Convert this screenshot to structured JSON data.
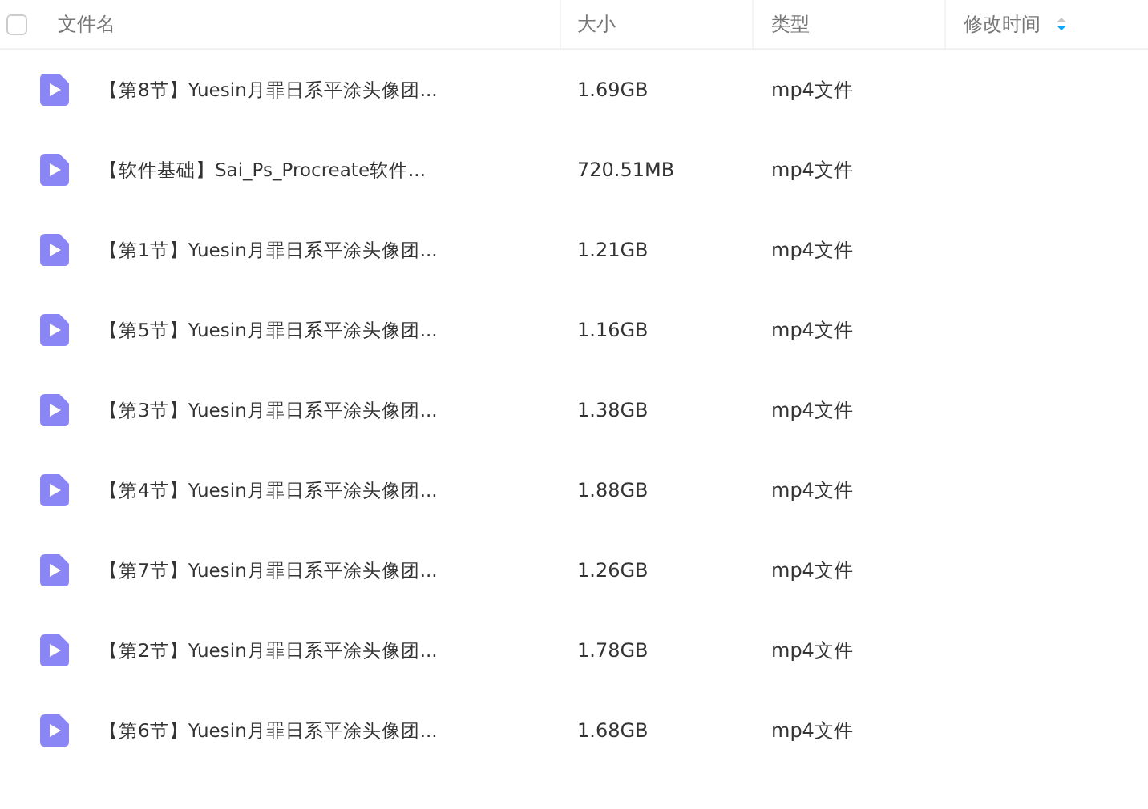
{
  "header": {
    "select_all_checked": false,
    "columns": [
      {
        "label": "文件名",
        "sorted": false
      },
      {
        "label": "大小",
        "sorted": false
      },
      {
        "label": "类型",
        "sorted": false
      },
      {
        "label": "修改时间",
        "sorted": true
      }
    ]
  },
  "rows": [
    {
      "name": "【第8节】Yuesin月罪日系平涂头像团...",
      "size": "1.69GB",
      "type": "mp4文件"
    },
    {
      "name": "【软件基础】Sai_Ps_Procreate软件...",
      "size": "720.51MB",
      "type": "mp4文件"
    },
    {
      "name": "【第1节】Yuesin月罪日系平涂头像团...",
      "size": "1.21GB",
      "type": "mp4文件"
    },
    {
      "name": "【第5节】Yuesin月罪日系平涂头像团...",
      "size": "1.16GB",
      "type": "mp4文件"
    },
    {
      "name": "【第3节】Yuesin月罪日系平涂头像团...",
      "size": "1.38GB",
      "type": "mp4文件"
    },
    {
      "name": "【第4节】Yuesin月罪日系平涂头像团...",
      "size": "1.88GB",
      "type": "mp4文件"
    },
    {
      "name": "【第7节】Yuesin月罪日系平涂头像团...",
      "size": "1.26GB",
      "type": "mp4文件"
    },
    {
      "name": "【第2节】Yuesin月罪日系平涂头像团...",
      "size": "1.78GB",
      "type": "mp4文件"
    },
    {
      "name": "【第6节】Yuesin月罪日系平涂头像团...",
      "size": "1.68GB",
      "type": "mp4文件"
    }
  ]
}
